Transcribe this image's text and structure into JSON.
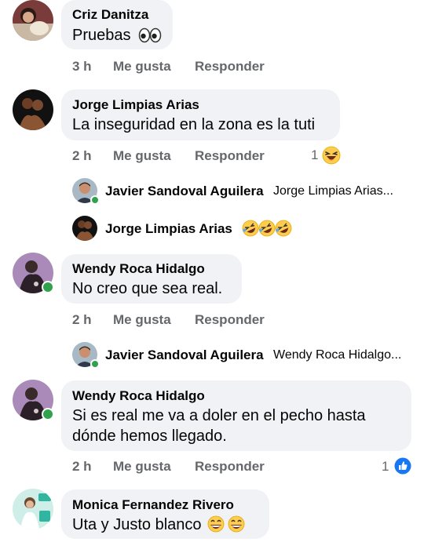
{
  "comments": [
    {
      "author": "Criz Danitza",
      "text": "Pruebas",
      "text_emoji": "eyes",
      "time": "3 h",
      "like_label": "Me gusta",
      "reply_label": "Responder"
    },
    {
      "author": "Jorge Limpias Arias",
      "text": "La inseguridad en la zona es la tuti",
      "time": "2 h",
      "like_label": "Me gusta",
      "reply_label": "Responder",
      "reaction_count": "1",
      "reaction_icon": "laughing-emoji",
      "replies": [
        {
          "author": "Javier Sandoval Aguilera",
          "preview": "Jorge Limpias Arias..."
        },
        {
          "author": "Jorge Limpias Arias",
          "preview_emoji": "rolling-laughing x3"
        }
      ]
    },
    {
      "author": "Wendy Roca Hidalgo",
      "text": "No creo que sea real.",
      "time": "2 h",
      "like_label": "Me gusta",
      "reply_label": "Responder",
      "online": true,
      "replies": [
        {
          "author": "Javier Sandoval Aguilera",
          "preview": "Wendy Roca Hidalgo..."
        }
      ]
    },
    {
      "author": "Wendy Roca Hidalgo",
      "text_line1": "Si es real me va a doler en el pecho hasta",
      "text_line2": "dónde hemos llegado.",
      "time": "2 h",
      "like_label": "Me gusta",
      "reply_label": "Responder",
      "reaction_count": "1",
      "reaction_icon": "like-icon",
      "online": true
    },
    {
      "author": "Monica Fernandez Rivero",
      "text": "Uta y Justo blanco",
      "text_emoji": "grinning x2"
    }
  ],
  "colors": {
    "bubble": "#f0f2f5",
    "meta": "#65676b",
    "online": "#31a24c",
    "like_blue": "#1877f2",
    "emoji_yellow": "#ffcc4d"
  }
}
